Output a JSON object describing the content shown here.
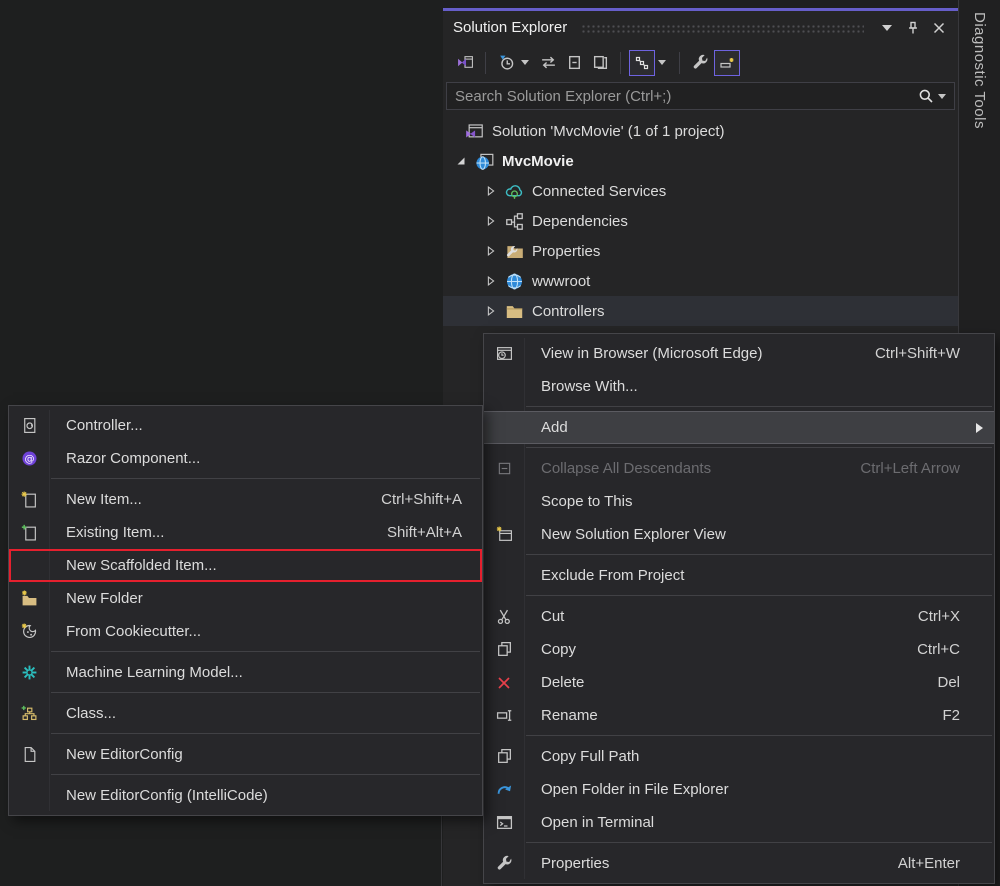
{
  "colors": {
    "accent_purple": "#665ec9",
    "toolbar_active_border": "#6e63e0",
    "red_annotation": "#e5202e",
    "panel_bg": "#252526",
    "menu_bg": "#27272a",
    "selection_bg": "#2e3036",
    "delete_red": "#e8414b",
    "link_blue": "#3a96dd",
    "folder_tan": "#d8bd82",
    "teal": "#2bbfbf"
  },
  "diagnostic_tools": {
    "label": "Diagnostic Tools"
  },
  "solution_explorer": {
    "title": "Solution Explorer",
    "titlebar_icons": [
      "window-menu-chevron",
      "pin-icon",
      "close-icon"
    ],
    "toolbar_icons": [
      "switch-views",
      "pending-changes-filter",
      "sync-arrows",
      "collapse-all",
      "show-all-files",
      "track-active-item",
      "properties-wrench",
      "preview-selected-items"
    ],
    "search_placeholder": "Search Solution Explorer (Ctrl+;)",
    "tree": [
      {
        "label": "Solution 'MvcMovie' (1 of 1 project)",
        "icon": "solution"
      },
      {
        "label": "MvcMovie",
        "icon": "web-project",
        "bold": true,
        "expanded": true
      },
      {
        "label": "Connected Services",
        "icon": "connected-services",
        "collapsed": true
      },
      {
        "label": "Dependencies",
        "icon": "dependencies",
        "collapsed": true
      },
      {
        "label": "Properties",
        "icon": "properties-folder",
        "collapsed": true
      },
      {
        "label": "wwwroot",
        "icon": "globe",
        "collapsed": true
      },
      {
        "label": "Controllers",
        "icon": "folder",
        "collapsed": true,
        "selected": true
      }
    ]
  },
  "context_menu": {
    "items": [
      {
        "type": "item",
        "name": "view-in-browser",
        "icon": "browser-window",
        "label": "View in Browser (Microsoft Edge)",
        "shortcut": "Ctrl+Shift+W"
      },
      {
        "type": "item",
        "name": "browse-with",
        "label": "Browse With..."
      },
      {
        "type": "separator"
      },
      {
        "type": "item",
        "name": "add",
        "label": "Add",
        "highlighted": true,
        "has_submenu": true
      },
      {
        "type": "separator"
      },
      {
        "type": "item",
        "name": "collapse-all-descendants",
        "icon": "collapse-box",
        "label": "Collapse All Descendants",
        "shortcut": "Ctrl+Left Arrow",
        "disabled": true
      },
      {
        "type": "item",
        "name": "scope-to-this",
        "label": "Scope to This"
      },
      {
        "type": "item",
        "name": "new-solution-explorer-view",
        "icon": "window-sparkle",
        "label": "New Solution Explorer View"
      },
      {
        "type": "separator"
      },
      {
        "type": "item",
        "name": "exclude-from-project",
        "label": "Exclude From Project"
      },
      {
        "type": "separator"
      },
      {
        "type": "item",
        "name": "cut",
        "icon": "scissors",
        "label": "Cut",
        "shortcut": "Ctrl+X"
      },
      {
        "type": "item",
        "name": "copy",
        "icon": "copy-pages",
        "label": "Copy",
        "shortcut": "Ctrl+C"
      },
      {
        "type": "item",
        "name": "delete",
        "icon": "red-x",
        "label": "Delete",
        "shortcut": "Del"
      },
      {
        "type": "item",
        "name": "rename",
        "icon": "rename-box",
        "label": "Rename",
        "shortcut": "F2"
      },
      {
        "type": "separator"
      },
      {
        "type": "item",
        "name": "copy-full-path",
        "icon": "copy-pages",
        "label": "Copy Full Path"
      },
      {
        "type": "item",
        "name": "open-folder-in-file-explorer",
        "icon": "curved-arrow",
        "label": "Open Folder in File Explorer"
      },
      {
        "type": "item",
        "name": "open-in-terminal",
        "icon": "terminal-window",
        "label": "Open in Terminal"
      },
      {
        "type": "separator"
      },
      {
        "type": "item",
        "name": "properties",
        "icon": "wrench",
        "label": "Properties",
        "shortcut": "Alt+Enter"
      }
    ]
  },
  "add_submenu": {
    "items": [
      {
        "type": "item",
        "name": "controller",
        "icon": "document-at",
        "label": "Controller..."
      },
      {
        "type": "item",
        "name": "razor-component",
        "icon": "razor-at",
        "label": "Razor Component..."
      },
      {
        "type": "separator"
      },
      {
        "type": "item",
        "name": "new-item",
        "icon": "document-sparkle",
        "label": "New Item...",
        "shortcut": "Ctrl+Shift+A"
      },
      {
        "type": "item",
        "name": "existing-item",
        "icon": "document-plus",
        "label": "Existing Item...",
        "shortcut": "Shift+Alt+A"
      },
      {
        "type": "item",
        "name": "new-scaffolded-item",
        "label": "New Scaffolded Item...",
        "annotated": true
      },
      {
        "type": "item",
        "name": "new-folder",
        "icon": "folder-sparkle",
        "label": "New Folder"
      },
      {
        "type": "item",
        "name": "from-cookiecutter",
        "icon": "cookie-sparkle",
        "label": "From Cookiecutter..."
      },
      {
        "type": "separator"
      },
      {
        "type": "item",
        "name": "machine-learning-model",
        "icon": "teal-gear",
        "label": "Machine Learning Model..."
      },
      {
        "type": "separator"
      },
      {
        "type": "item",
        "name": "class",
        "icon": "class-diagram-plus",
        "label": "Class..."
      },
      {
        "type": "separator"
      },
      {
        "type": "item",
        "name": "new-editorconfig",
        "icon": "document-blank",
        "label": "New EditorConfig"
      },
      {
        "type": "separator"
      },
      {
        "type": "item",
        "name": "new-editorconfig-intellicode",
        "label": "New EditorConfig (IntelliCode)"
      }
    ]
  }
}
